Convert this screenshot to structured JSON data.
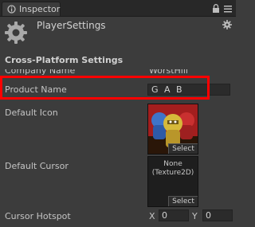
{
  "window": {
    "tab_title": "Inspector",
    "icons": [
      "inspector-icon",
      "lock-icon",
      "menu-icon"
    ]
  },
  "header": {
    "title": "PlayerSettings",
    "icons": [
      "gear-icon",
      "settings-gear-icon"
    ]
  },
  "section": {
    "title": "Cross-Platform Settings"
  },
  "fields": {
    "company_name": {
      "label": "Company Name",
      "value": "WorstHill"
    },
    "product_name": {
      "label": "Product Name",
      "value": "G A B"
    },
    "default_icon": {
      "label": "Default Icon",
      "select_label": "Select"
    },
    "default_cursor": {
      "label": "Default Cursor",
      "value_line1": "None",
      "value_line2": "(Texture2D)",
      "select_label": "Select"
    },
    "cursor_hotspot": {
      "label": "Cursor Hotspot",
      "x_label": "X",
      "x_value": "0",
      "y_label": "Y",
      "y_value": "0"
    }
  },
  "colors": {
    "highlight": "#ff0000",
    "background": "#3c3c3c"
  }
}
